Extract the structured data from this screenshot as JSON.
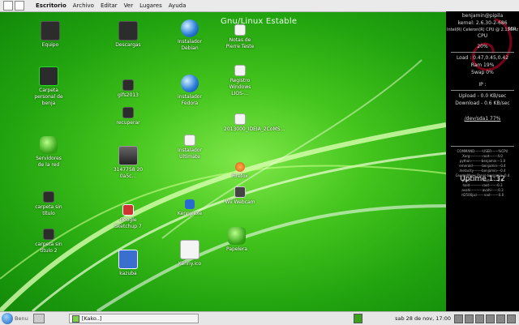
{
  "topbar": {
    "menus": [
      "Escritorio",
      "Archivo",
      "Editar",
      "Ver",
      "Lugares",
      "Ayuda"
    ]
  },
  "wallpaper": {
    "title": "Gnu/Linux Estable"
  },
  "desktop_icons": [
    {
      "label": "Equipo",
      "icon": "computer-icon"
    },
    {
      "label": "Carpeta personal de benja",
      "icon": "home-folder-icon"
    },
    {
      "label": "Servidores de la red",
      "icon": "network-icon"
    },
    {
      "label": "carpeta sin título",
      "icon": "folder-icon"
    },
    {
      "label": "carpeta sin título 2",
      "icon": "folder-icon"
    },
    {
      "label": "Descargas",
      "icon": "downloads-folder-icon"
    },
    {
      "label": "gifs2013",
      "icon": "folder-icon"
    },
    {
      "label": "recuperar",
      "icon": "folder-icon"
    },
    {
      "label": "3147758 20 0a5c...",
      "icon": "image-icon"
    },
    {
      "label": "Google Sketchup 7",
      "icon": "sketchup-icon"
    },
    {
      "label": "kazuba",
      "icon": "app-icon"
    },
    {
      "label": "Instalador Debian",
      "icon": "installer-globe-icon"
    },
    {
      "label": "instalador Fedora",
      "icon": "installer-globe-icon"
    },
    {
      "label": "Instalador Ultimate",
      "icon": "installer-icon"
    },
    {
      "label": "Kenny.exe",
      "icon": "executable-icon"
    },
    {
      "label": "Kenny.ico",
      "icon": "document-icon"
    },
    {
      "label": "Notas de Pierre Teste",
      "icon": "document-icon"
    },
    {
      "label": "Registro Windows LIOS-...",
      "icon": "document-icon"
    },
    {
      "label": "2013000_IDEIA_2CoMS...",
      "icon": "document-icon"
    },
    {
      "label": "Firefox",
      "icon": "firefox-icon"
    },
    {
      "label": "Wii Webcam",
      "icon": "webcam-icon"
    },
    {
      "label": "Papelera",
      "icon": "trash-icon"
    }
  ],
  "conky": {
    "user": "benjamin@pipila",
    "kernel": "kernel: 2.6.30-2-686",
    "cpu_model": "Intel(R) Celeron(R) CPU @ 2.13GHz",
    "cpu_freq": "560",
    "cpu_label": "CPU",
    "cpu_pct": "20%",
    "load": "Load : 0.47,0.45,0.42",
    "ram": "Ram 19%",
    "swap": "Swap 0%",
    "ip": "IP :",
    "upload": "Upload - 0.0 KB/sec",
    "download": "Download - 0.6 KB/sec",
    "disk": "/dev/sda1 77%",
    "proc_header": "COMMAND-------USER------%CPU",
    "procs": [
      "Xorg-----------root-------4.0",
      "python---------benjamin---1.0",
      "emerald--------benjamin---0.4",
      "metacity-------benjamin---0.4",
      "GnomeMenu.Panel-benjamin--0.4",
      "phy0-----------root-------0.3",
      "hald-----------root-------0.3",
      "avahi----------avahi------0.3",
      "rt2500pci------root-------0.0"
    ],
    "uptime": "Uptime 1:32"
  },
  "bottombar": {
    "start_label": "Benu",
    "task_label": "[Kako..]",
    "clock": "sab 28 de nov, 17:00"
  }
}
